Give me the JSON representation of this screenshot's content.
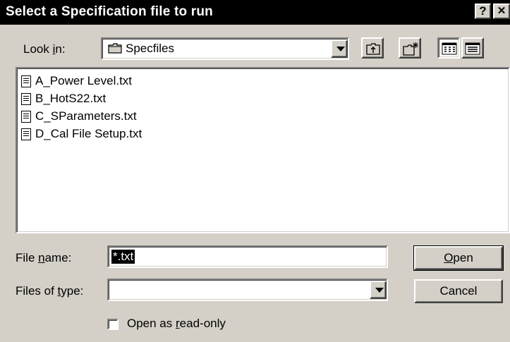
{
  "dialog": {
    "title": "Select a Specification file to run",
    "help_button": "?",
    "close_button": "✕"
  },
  "look_in": {
    "label_pre": "Look ",
    "label_key": "i",
    "label_post": "n:",
    "value": "Specfiles"
  },
  "toolbar": {
    "up_folder_icon": "up-folder-icon",
    "new_folder_icon": "new-folder-icon",
    "list_view_icon": "list-view-icon",
    "details_view_icon": "details-view-icon"
  },
  "files": [
    {
      "name": "A_Power Level.txt"
    },
    {
      "name": "B_HotS22.txt"
    },
    {
      "name": "C_SParameters.txt"
    },
    {
      "name": "D_Cal File Setup.txt"
    }
  ],
  "file_name": {
    "label_pre": "File ",
    "label_key": "n",
    "label_post": "ame:",
    "value": "*.txt"
  },
  "file_type": {
    "label_pre": "Files of ",
    "label_key": "t",
    "label_post": "ype:",
    "value": ""
  },
  "buttons": {
    "open_key": "O",
    "open_rest": "pen",
    "cancel": "Cancel"
  },
  "read_only": {
    "label_pre": "Open as ",
    "label_key": "r",
    "label_post": "ead-only",
    "checked": false
  }
}
